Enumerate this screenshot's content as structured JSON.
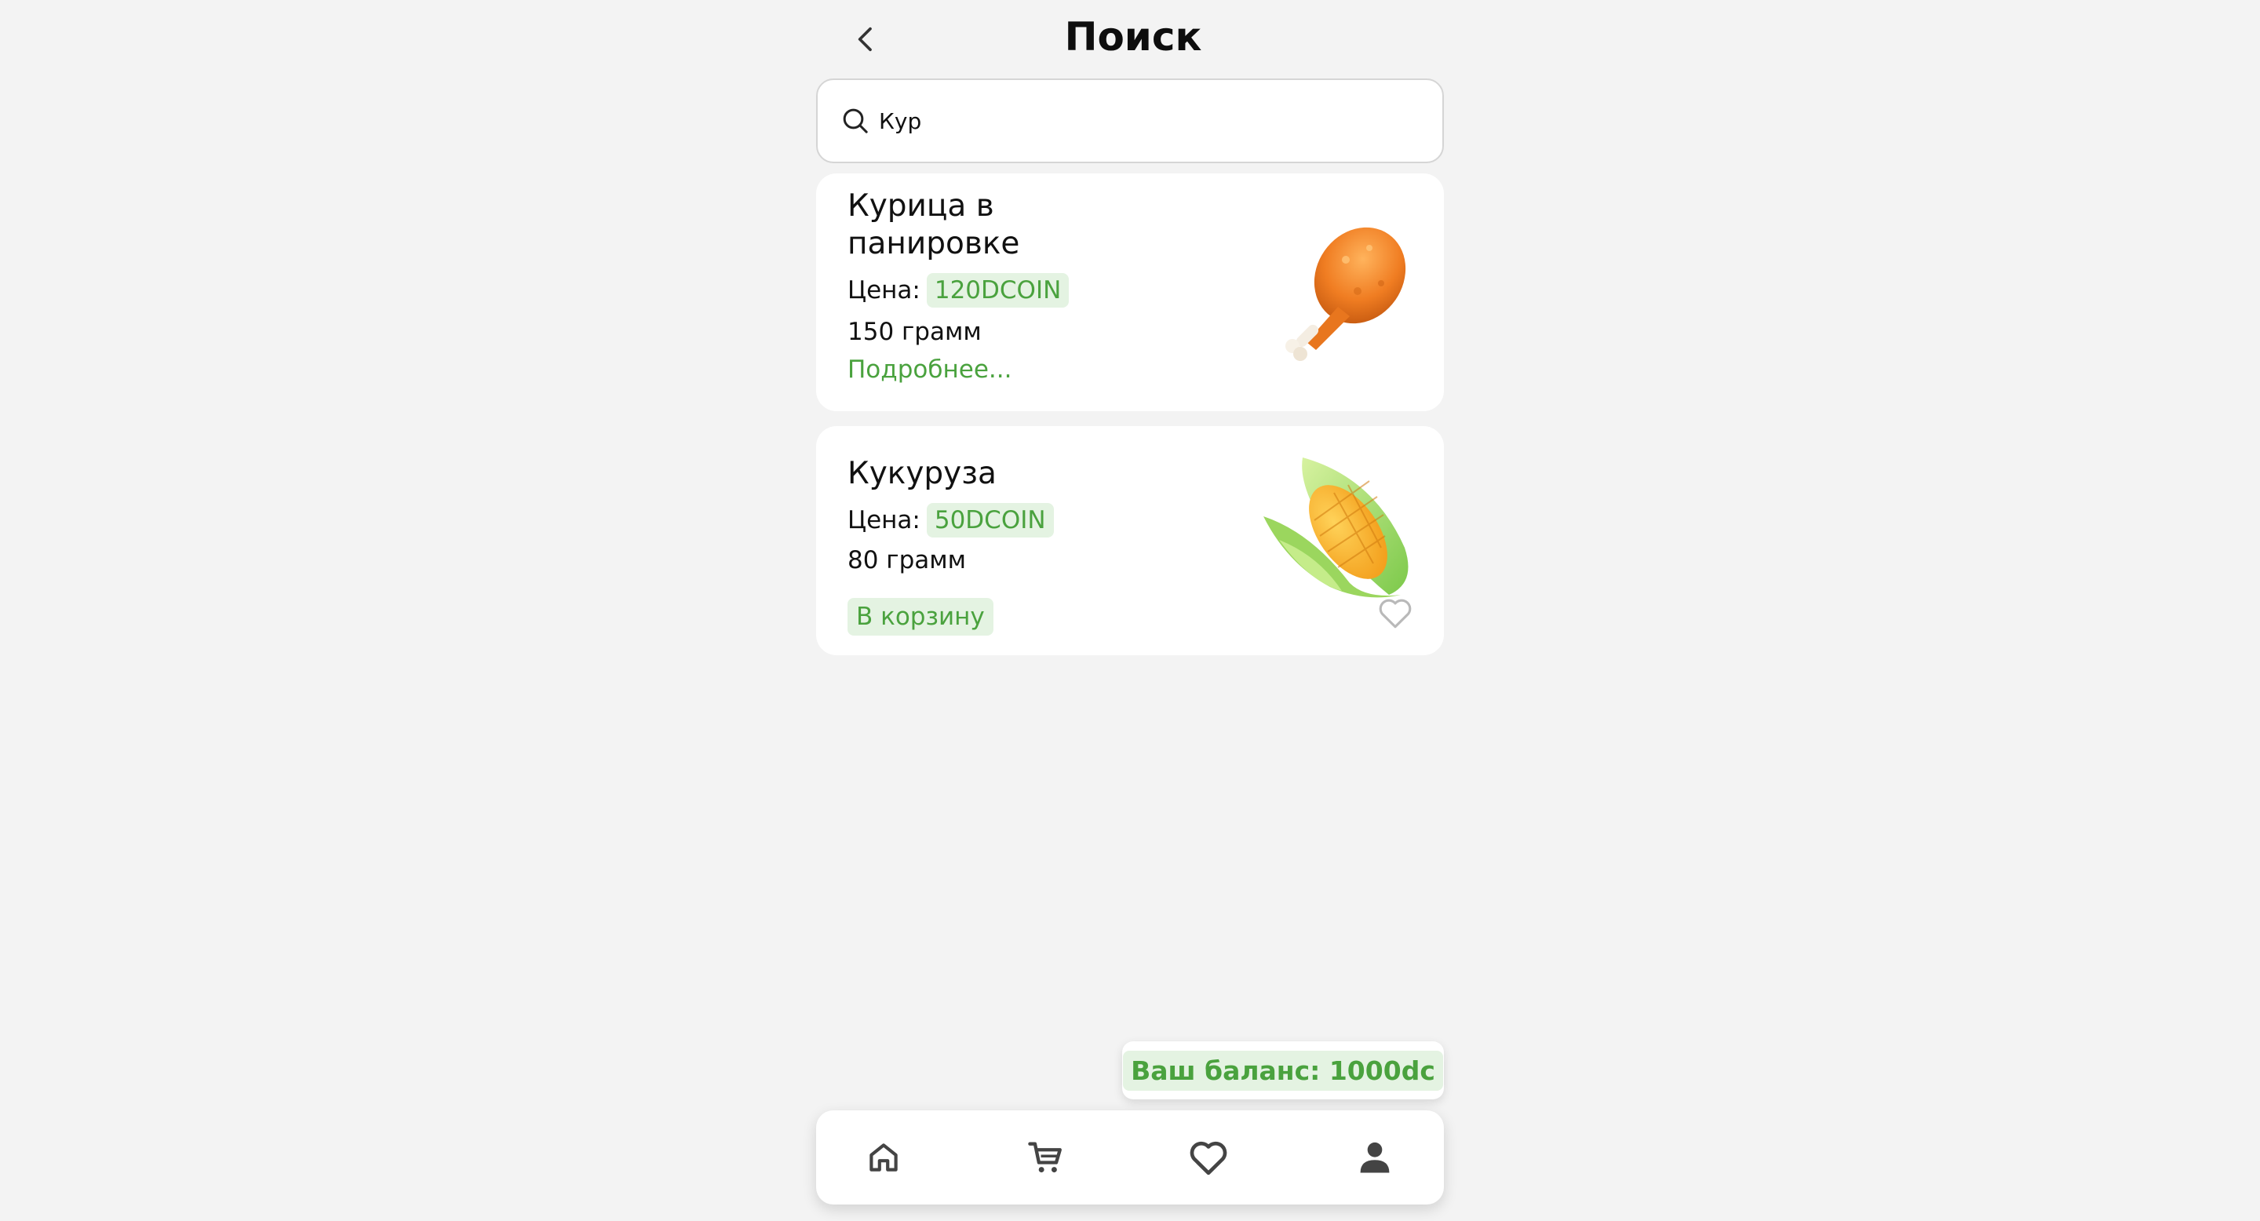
{
  "header": {
    "title": "Поиск",
    "back_icon": "chevron-left-icon"
  },
  "search": {
    "value": "Кур",
    "icon": "search-icon"
  },
  "products": [
    {
      "name": "Курица в панировке",
      "price_label": "Цена:",
      "price": "120DCOIN",
      "weight": "150 грамм",
      "action": "Подробнее...",
      "image": "chicken-leg-image"
    },
    {
      "name": "Кукуруза",
      "price_label": "Цена:",
      "price": "50DCOIN",
      "weight": "80 грамм",
      "action": "В корзину",
      "image": "corn-image",
      "favorite_icon": "heart-outline-icon"
    }
  ],
  "balance": {
    "text": "Ваш баланс: 1000dc"
  },
  "nav": [
    {
      "icon": "home-icon"
    },
    {
      "icon": "cart-icon"
    },
    {
      "icon": "heart-icon"
    },
    {
      "icon": "profile-icon"
    }
  ],
  "colors": {
    "accent": "#4aa23e",
    "accent_bg": "#e4f3e2",
    "background": "#f3f3f3"
  }
}
